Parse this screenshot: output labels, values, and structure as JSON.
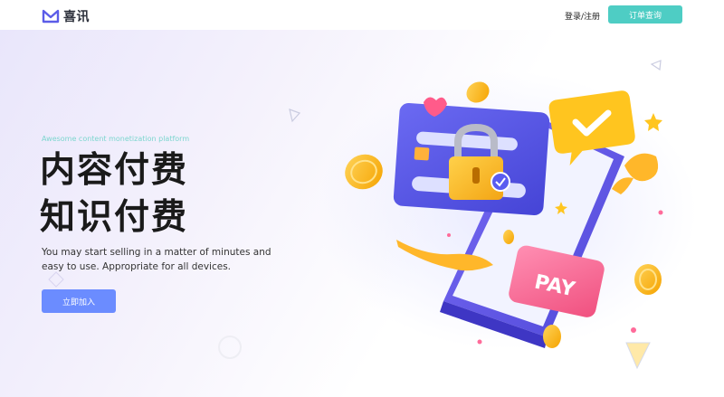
{
  "header": {
    "brand": "喜讯",
    "auth_link": "登录/注册",
    "order_button": "订单查询"
  },
  "hero": {
    "tagline": "Awesome content monetization platform",
    "title_line1": "内容付费",
    "title_line2": "知识付费",
    "description": "You may start selling in a matter of minutes and easy to use. Appropriate for all devices.",
    "join_button": "立即加入"
  },
  "illustration": {
    "pay_label": "PAY"
  },
  "colors": {
    "accent_teal": "#4ecdc4",
    "button_blue": "#6b8cff",
    "card_purple": "#5b5ce8",
    "pay_pink": "#ff6b9a",
    "coin_yellow": "#ffc22e"
  }
}
